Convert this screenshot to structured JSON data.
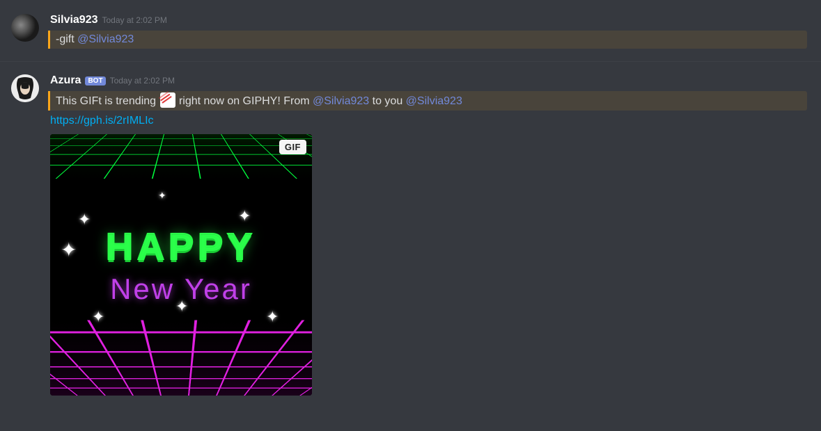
{
  "messages": [
    {
      "username": "Silvia923",
      "timestamp": "Today at 2:02 PM",
      "is_bot": false,
      "content": {
        "prefix": "-gift ",
        "mention": "@Silvia923"
      }
    },
    {
      "username": "Azura",
      "timestamp": "Today at 2:02 PM",
      "is_bot": true,
      "bot_label": "BOT",
      "content": {
        "part1": "This GIFt is trending ",
        "emoji_name": "chart-increasing",
        "part2": " right now on GIPHY! From ",
        "mention1": "@Silvia923",
        "part3": " to you ",
        "mention2": "@Silvia923"
      },
      "link": "https://gph.is/2rIMLIc",
      "gif": {
        "badge": "GIF",
        "line1": "HAPPY",
        "line2": "New Year"
      }
    }
  ]
}
